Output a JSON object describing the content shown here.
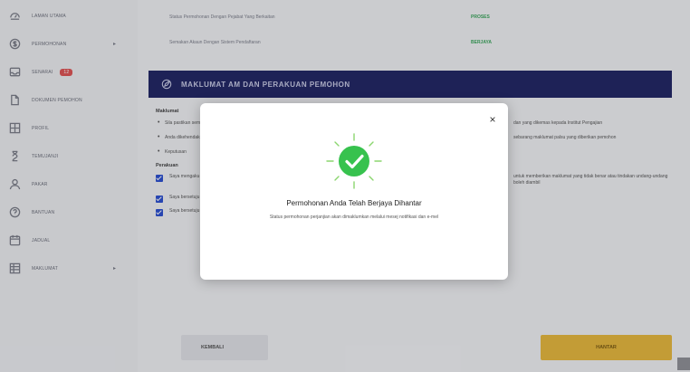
{
  "sidebar": {
    "items": [
      {
        "label": "LAMAN UTAMA",
        "icon": "dashboard-icon"
      },
      {
        "label": "PERMOHONAN",
        "icon": "dollar-circle-icon",
        "caret": "▸"
      },
      {
        "label": "SENARAI",
        "icon": "inbox-icon",
        "badge": "12"
      },
      {
        "label": "DOKUMEN PEMOHON",
        "icon": "document-icon"
      },
      {
        "label": "PROFIL",
        "icon": "grid-icon"
      },
      {
        "label": "TEMUJANJI",
        "icon": "clock-icon"
      },
      {
        "label": "PAKAR",
        "icon": "user-icon"
      },
      {
        "label": "BANTUAN",
        "icon": "help-circle-icon"
      },
      {
        "label": "JADUAL",
        "icon": "calendar-icon"
      },
      {
        "label": "MAKLUMAT",
        "icon": "table-icon",
        "caret": "▸"
      }
    ]
  },
  "info": {
    "row1_label": "Status Permohonan Dengan Pejabat Yang Berkaitan",
    "row1_value": "PROSES",
    "row2_label": "Semakan Akaun Dengan Sistem Pendaftaran",
    "row2_value": "BERJAYA"
  },
  "banner": {
    "title": "MAKLUMAT AM DAN PERAKUAN PEMOHON"
  },
  "content": {
    "section1_title": "Maklumat",
    "bullet1_left": "Sila pastikan semua maklumat adalah benar dan Tepat",
    "bullet1_right": "dan yang dikemas kepada Institut Pengajian",
    "bullet2_left": "Anda dikehendaki menyerahkan permohonan",
    "bullet2_right": "sebarang maklumat palsu yang diberikan pemohon",
    "bullet3_left": "Keputusan",
    "section2_title": "Perakuan",
    "check1_left": "Saya mengaku bahawa segala maklumat adalah benar",
    "check1_right": "untuk memberikan maklumat yang tidak benar atau tindakan undang-undang boleh diambil",
    "check2_left": "Saya bersetuju",
    "check3": "Saya bersetuju menerima maklumbalas permohonan melalui notifikasi sistem"
  },
  "buttons": {
    "back": "KEMBALI",
    "submit": "HANTAR"
  },
  "modal": {
    "close": "×",
    "title": "Permohonan Anda Telah Berjaya Dihantar",
    "subtitle": "Status permohonan perjanjian akan dimaklumkan melalui mesej notifikasi dan e-mel"
  },
  "colors": {
    "accent": "#1f2463",
    "success": "#37c24e",
    "submit": "#e8b93b"
  }
}
